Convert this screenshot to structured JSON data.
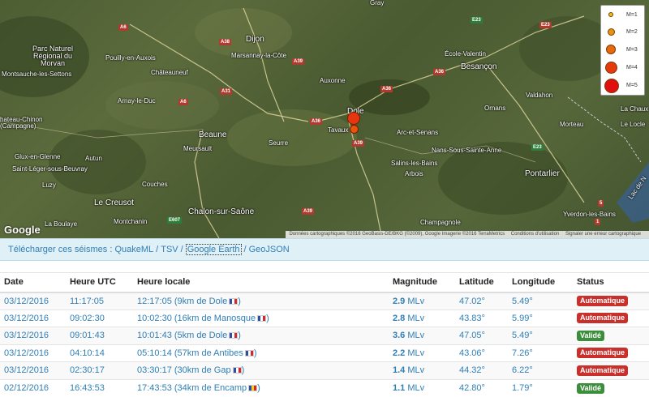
{
  "map": {
    "places": [
      {
        "key": "gray",
        "label": "Gray"
      },
      {
        "key": "dijon",
        "label": "Dijon"
      },
      {
        "key": "parc_morvan",
        "label": "Parc Naturel Régional du Morvan"
      },
      {
        "key": "pouilly",
        "label": "Pouilly-en-Auxois"
      },
      {
        "key": "marsannay",
        "label": "Marsannay-la-Côte"
      },
      {
        "key": "chateauneuf",
        "label": "Châteauneuf"
      },
      {
        "key": "montsauche",
        "label": "Montsauche-les-Settons"
      },
      {
        "key": "ecole",
        "label": "École-Valentin"
      },
      {
        "key": "besancon",
        "label": "Besançon"
      },
      {
        "key": "auxonne",
        "label": "Auxonne"
      },
      {
        "key": "arnay",
        "label": "Arnay-le-Duc"
      },
      {
        "key": "chateau_chinon",
        "label": "hateau-Chinon (Campagne)"
      },
      {
        "key": "dole",
        "label": "Dole"
      },
      {
        "key": "tavaux",
        "label": "Tavaux"
      },
      {
        "key": "ornans",
        "label": "Ornans"
      },
      {
        "key": "valdahon",
        "label": "Valdahon"
      },
      {
        "key": "beaune",
        "label": "Beaune"
      },
      {
        "key": "meursault",
        "label": "Meursault"
      },
      {
        "key": "seurre",
        "label": "Seurre"
      },
      {
        "key": "arc_senans",
        "label": "Arc-et-Senans"
      },
      {
        "key": "morteau",
        "label": "Morteau"
      },
      {
        "key": "le_locle",
        "label": "Le Locle"
      },
      {
        "key": "la_chaux",
        "label": "La Chaux"
      },
      {
        "key": "nans",
        "label": "Nans-Sous-Sainte-Anne"
      },
      {
        "key": "glux",
        "label": "Glux-en-Glenne"
      },
      {
        "key": "autun",
        "label": "Autun"
      },
      {
        "key": "saint_leger",
        "label": "Saint-Léger-sous-Beuvray"
      },
      {
        "key": "salins",
        "label": "Salins-les-Bains"
      },
      {
        "key": "arbois",
        "label": "Arbois"
      },
      {
        "key": "pontarlier",
        "label": "Pontarlier"
      },
      {
        "key": "couches",
        "label": "Couches"
      },
      {
        "key": "luzy",
        "label": "Luzy"
      },
      {
        "key": "le_creusot",
        "label": "Le Creusot"
      },
      {
        "key": "chalon",
        "label": "Chalon-sur-Saône"
      },
      {
        "key": "champagnole",
        "label": "Champagnole"
      },
      {
        "key": "yverdon",
        "label": "Yverdon-les-Bains"
      },
      {
        "key": "lac",
        "label": "Lac de N"
      },
      {
        "key": "la_boulaye",
        "label": "La Boulaye"
      },
      {
        "key": "montchanin",
        "label": "Montchanin"
      }
    ],
    "roads": [
      "A6",
      "A38",
      "A39",
      "A31",
      "A36",
      "A6",
      "A36",
      "A39",
      "A36",
      "E23",
      "E23",
      "E607",
      "A39",
      "E23",
      "5",
      "1"
    ],
    "legend": [
      {
        "label": "M=1",
        "color": "#e8c20c"
      },
      {
        "label": "M=2",
        "color": "#e8940c"
      },
      {
        "label": "M=3",
        "color": "#e8680c"
      },
      {
        "label": "M=4",
        "color": "#e53a10"
      },
      {
        "label": "M=5",
        "color": "#e01010"
      }
    ],
    "google_logo": "Google",
    "attribution": {
      "data": "Données cartographiques ©2016 GeoBasis-DE/BKG (©2009), Google Imagerie ©2016 TerraMetrics",
      "terms": "Conditions d'utilisation",
      "report": "Signaler une erreur cartographique"
    }
  },
  "download": {
    "label": "Télécharger ces séismes :",
    "links": [
      "QuakeML",
      "TSV",
      "Google Earth",
      "GeoJSON"
    ]
  },
  "table": {
    "headers": [
      "Date",
      "Heure UTC",
      "Heure locale",
      "Magnitude",
      "Latitude",
      "Longitude",
      "Status"
    ],
    "rows": [
      {
        "date": "03/12/2016",
        "utc": "11:17:05",
        "local": "12:17:05 (9km de Dole",
        "mag": "2.9",
        "unit": "MLv",
        "lat": "47.02°",
        "lon": "5.49°",
        "status": "Automatique"
      },
      {
        "date": "03/12/2016",
        "utc": "09:02:30",
        "local": "10:02:30 (16km de Manosque",
        "mag": "2.8",
        "unit": "MLv",
        "lat": "43.83°",
        "lon": "5.99°",
        "status": "Automatique"
      },
      {
        "date": "03/12/2016",
        "utc": "09:01:43",
        "local": "10:01:43 (5km de Dole",
        "mag": "3.6",
        "unit": "MLv",
        "lat": "47.05°",
        "lon": "5.49°",
        "status": "Validé"
      },
      {
        "date": "03/12/2016",
        "utc": "04:10:14",
        "local": "05:10:14 (57km de Antibes",
        "mag": "2.2",
        "unit": "MLv",
        "lat": "43.06°",
        "lon": "7.26°",
        "status": "Automatique"
      },
      {
        "date": "03/12/2016",
        "utc": "02:30:17",
        "local": "03:30:17 (30km de Gap",
        "mag": "1.4",
        "unit": "MLv",
        "lat": "44.32°",
        "lon": "6.22°",
        "status": "Automatique"
      },
      {
        "date": "02/12/2016",
        "utc": "16:43:53",
        "local": "17:43:53 (34km de Encamp",
        "mag": "1.1",
        "unit": "MLv",
        "lat": "42.80°",
        "lon": "1.79°",
        "status": "Validé"
      }
    ]
  }
}
